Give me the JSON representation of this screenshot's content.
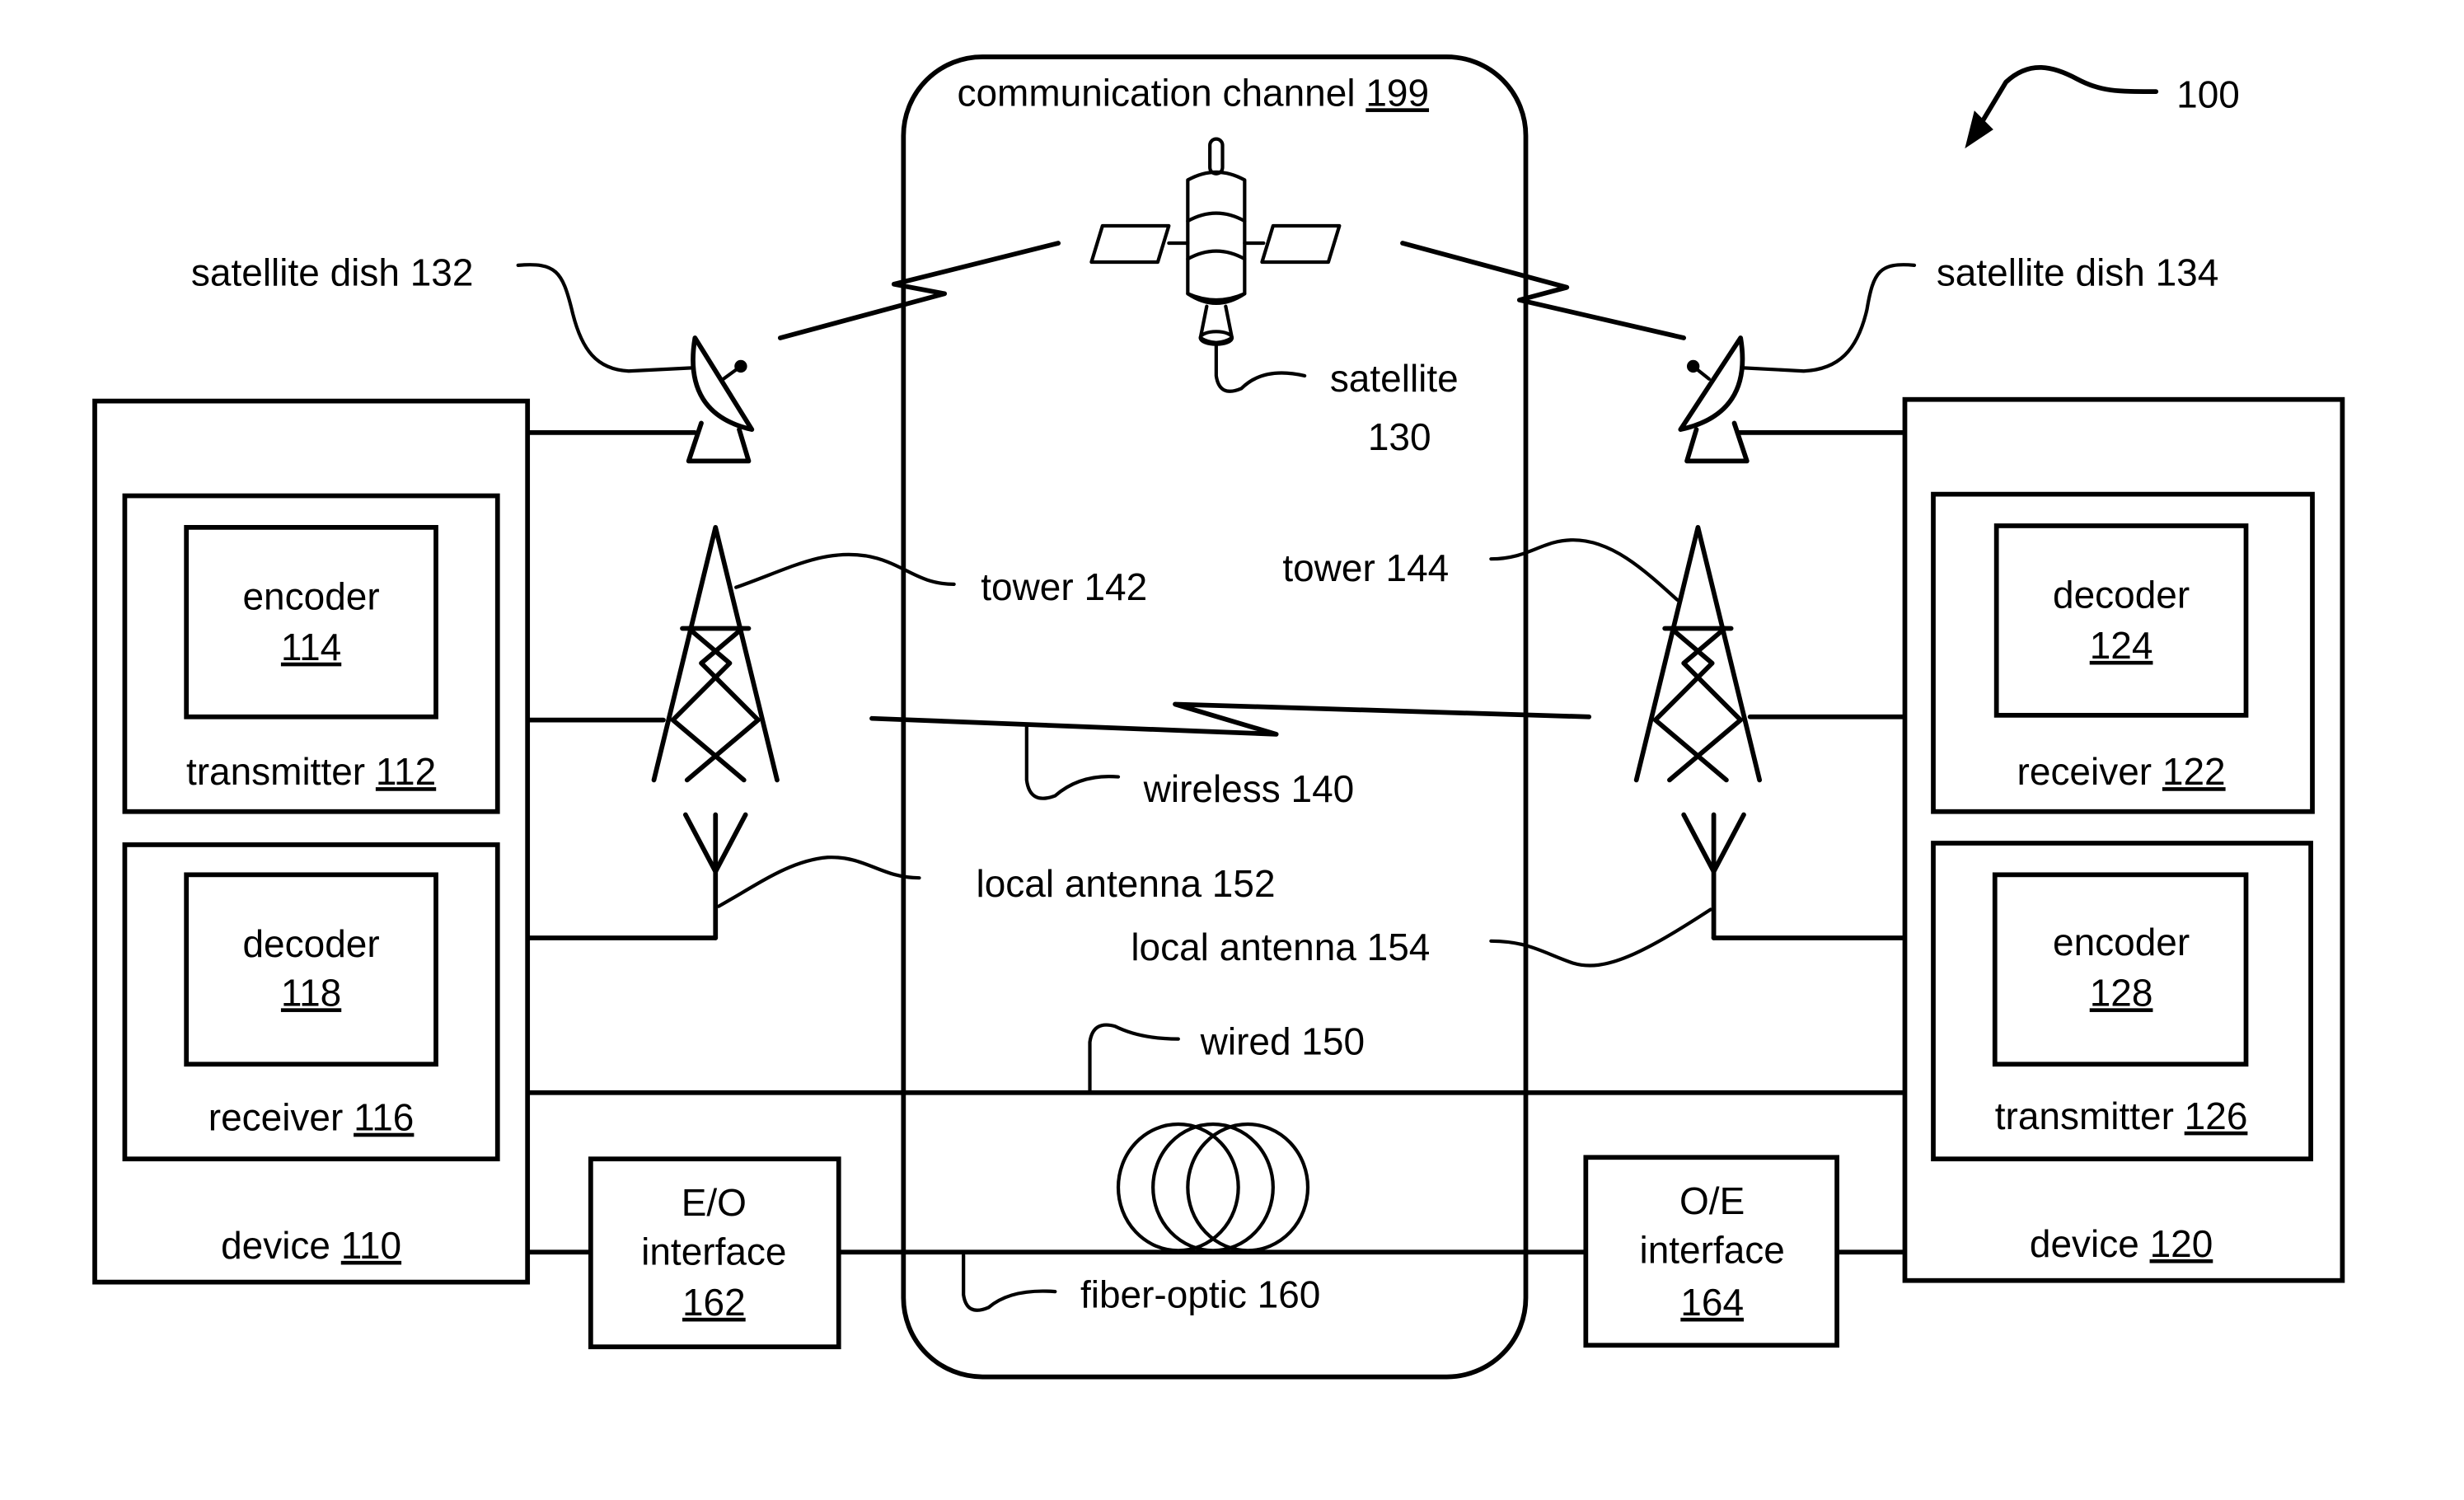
{
  "figure": {
    "reference_numeral": "100",
    "channel": {
      "label": "communication channel ",
      "ref": "199"
    },
    "satellite": {
      "label_line1": "satellite",
      "label_line2": "130"
    },
    "satellite_dish_left": {
      "label": "satellite dish 132"
    },
    "satellite_dish_right": {
      "label": "satellite dish 134"
    },
    "tower_left": {
      "label": "tower 142"
    },
    "tower_right": {
      "label": "tower 144"
    },
    "wireless": {
      "label": "wireless 140"
    },
    "local_antenna_left": {
      "label": "local antenna 152"
    },
    "local_antenna_right": {
      "label": "local antenna 154"
    },
    "wired": {
      "label": "wired 150"
    },
    "fiber_optic": {
      "label": "fiber-optic 160"
    },
    "eo_interface": {
      "line1": "E/O",
      "line2": "interface",
      "ref": "162"
    },
    "oe_interface": {
      "line1": "O/E",
      "line2": "interface",
      "ref": "164"
    },
    "device_left": {
      "label": "device ",
      "ref": "110",
      "transmitter": {
        "label": "transmitter ",
        "ref": "112",
        "encoder": {
          "label": "encoder",
          "ref": "114"
        }
      },
      "receiver": {
        "label": "receiver ",
        "ref": "116",
        "decoder": {
          "label": "decoder",
          "ref": "118"
        }
      }
    },
    "device_right": {
      "label": "device ",
      "ref": "120",
      "receiver": {
        "label": "receiver ",
        "ref": "122",
        "decoder": {
          "label": "decoder",
          "ref": "124"
        }
      },
      "transmitter": {
        "label": "transmitter ",
        "ref": "126",
        "encoder": {
          "label": "encoder",
          "ref": "128"
        }
      }
    }
  }
}
